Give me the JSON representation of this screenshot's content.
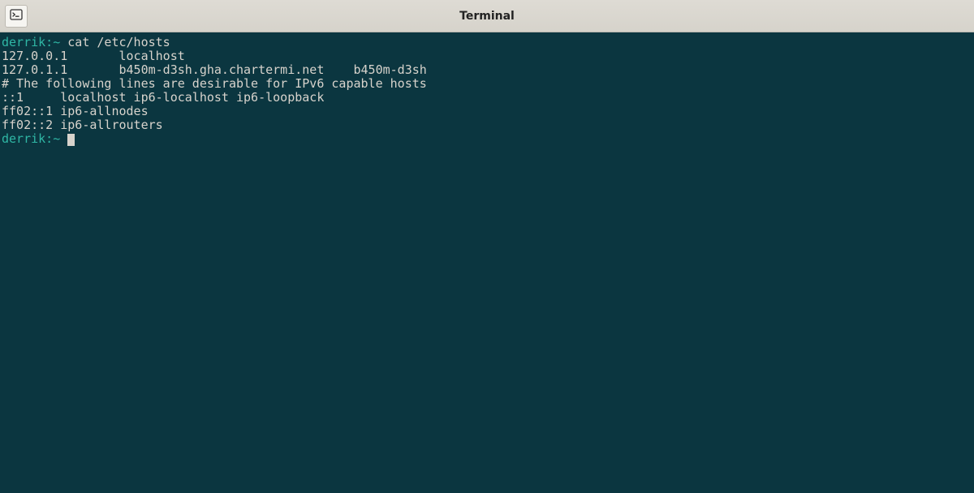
{
  "window": {
    "title": "Terminal"
  },
  "terminal": {
    "prompt1": "derrik:~",
    "command1": " cat /etc/hosts",
    "lines": [
      "127.0.0.1       localhost",
      "127.0.1.1       b450m-d3sh.gha.chartermi.net    b450m-d3sh",
      "",
      "# The following lines are desirable for IPv6 capable hosts",
      "::1     localhost ip6-localhost ip6-loopback",
      "ff02::1 ip6-allnodes",
      "ff02::2 ip6-allrouters"
    ],
    "prompt2": "derrik:~",
    "command2": " "
  }
}
